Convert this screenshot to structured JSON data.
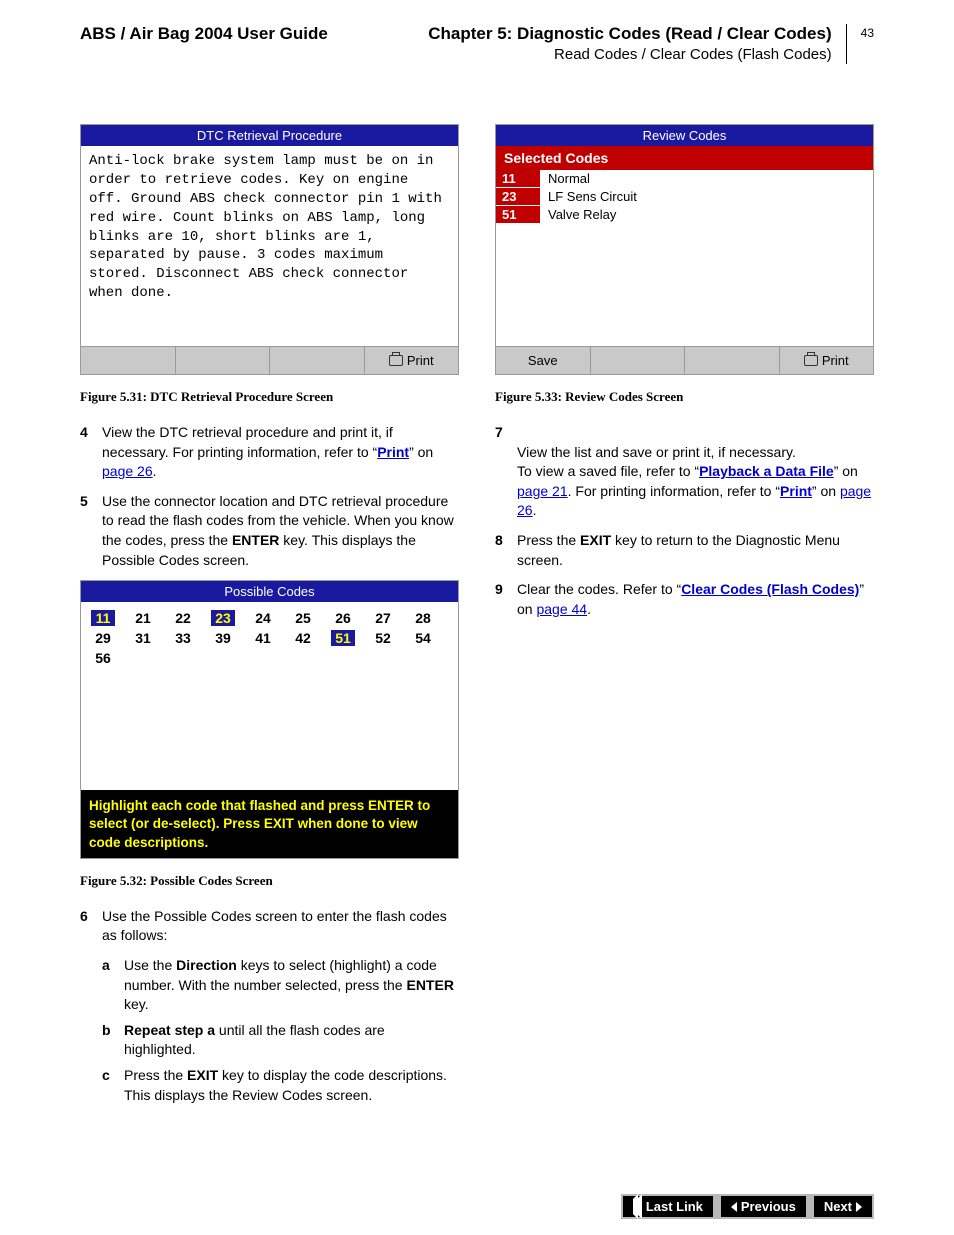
{
  "header": {
    "left": "ABS / Air Bag 2004 User Guide",
    "chapter": "Chapter 5: Diagnostic Codes (Read / Clear Codes)",
    "sub": "Read Codes / Clear Codes (Flash Codes)",
    "page_num": "43"
  },
  "left_col": {
    "dtc_screen": {
      "title": "DTC Retrieval Procedure",
      "body": "Anti-lock brake system lamp must be on in order to retrieve codes. Key on engine off. Ground ABS check connector pin 1 with red wire. Count blinks on ABS lamp, long blinks are 10, short blinks are 1, separated by pause. 3 codes maximum stored. Disconnect ABS check connector when done.",
      "print_label": "Print"
    },
    "fig31": "Figure 5.31: DTC Retrieval Procedure Screen",
    "step4": {
      "n": "4",
      "text_a": "View the DTC retrieval procedure and print it, if necessary. For printing information, refer to “",
      "link1": "Print",
      "text_b": "” on ",
      "link2": "page 26",
      "text_c": "."
    },
    "step5": {
      "n": "5",
      "text_a": "Use the connector location and DTC retrieval procedure to read the flash codes from the vehicle. When you know the codes, press the ",
      "enter": "ENTER",
      "text_b": " key. This displays the Possible Codes screen."
    },
    "possible_screen": {
      "title": "Possible Codes",
      "codes": [
        [
          "11",
          "21",
          "22",
          "23",
          "24",
          "25",
          "26",
          "27",
          "28"
        ],
        [
          "29",
          "31",
          "33",
          "39",
          "41",
          "42",
          "51",
          "52",
          "54"
        ],
        [
          "56"
        ]
      ],
      "selected": [
        "11",
        "23",
        "51"
      ],
      "hint": "Highlight each code that flashed and press ENTER to select (or de-select). Press EXIT when done to view code descriptions."
    },
    "fig32": "Figure 5.32: Possible Codes Screen",
    "step6": {
      "n": "6",
      "text": "Use the Possible Codes screen to enter the flash codes as follows:",
      "a": {
        "n": "a",
        "t1": "Use the ",
        "dir": "Direction",
        "t2": " keys to select (highlight) a code number. With the number selected, press the ",
        "enter": "ENTER",
        "t3": " key."
      },
      "b": {
        "n": "b",
        "bold": "Repeat step a",
        "rest": " until all the flash codes are highlighted."
      },
      "c": {
        "n": "c",
        "t1": "Press the ",
        "exit": "EXIT",
        "t2": " key to display the code descriptions. This displays the Review Codes screen."
      }
    }
  },
  "right_col": {
    "review_screen": {
      "title": "Review Codes",
      "selected_label": "Selected Codes",
      "rows": [
        {
          "code": "11",
          "desc": "Normal"
        },
        {
          "code": "23",
          "desc": "LF Sens Circuit"
        },
        {
          "code": "51",
          "desc": "Valve Relay"
        }
      ],
      "save_label": "Save",
      "print_label": "Print"
    },
    "fig33": "Figure 5.33: Review Codes Screen",
    "step7": {
      "n": "7",
      "t1": "View the list and save or print it, if necessary.\nTo view a saved file, refer to “",
      "link1": "Playback a Data File",
      "t2": "” on ",
      "link2": "page 21",
      "t3": ". For printing information, refer to “",
      "link3": "Print",
      "t4": "” on ",
      "link4": "page 26",
      "t5": "."
    },
    "step8": {
      "n": "8",
      "t1": "Press the ",
      "exit": "EXIT",
      "t2": " key to return to the Diagnostic Menu screen."
    },
    "step9": {
      "n": "9",
      "t1": "Clear the codes. Refer to “",
      "link1": "Clear Codes (Flash Codes)",
      "t2": "” on ",
      "link2": "page 44",
      "t3": "."
    }
  },
  "nav": {
    "last_link": "Last Link",
    "previous": "Previous",
    "next": "Next"
  }
}
